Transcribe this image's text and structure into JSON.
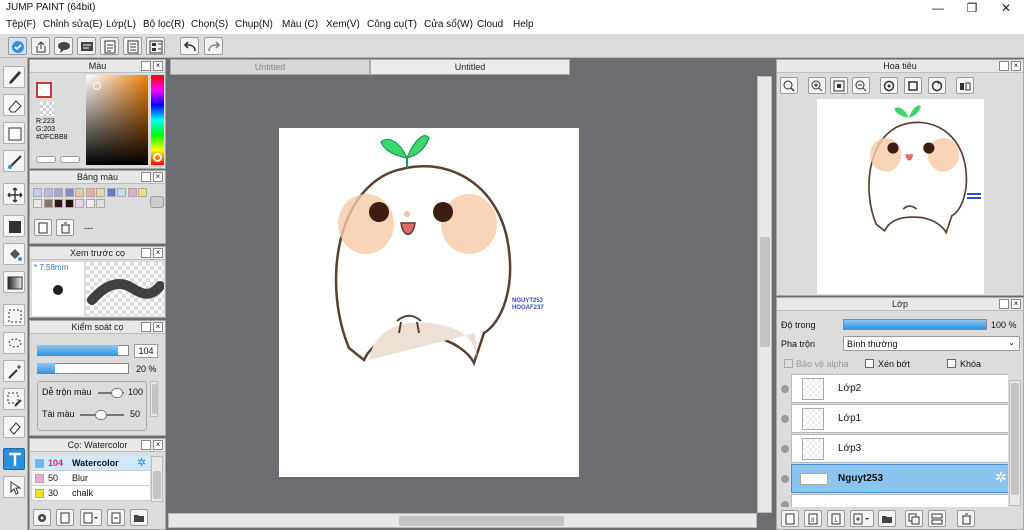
{
  "app": {
    "title": "JUMP PAINT (64bit)",
    "minimize": "—",
    "maximize": "❐",
    "close": "✕"
  },
  "menu": [
    "Tệp(F)",
    "Chỉnh sửa(E)",
    "Lớp(L)",
    "Bộ lọc(R)",
    "Chọn(S)",
    "Chụp(N)",
    "Màu (C)",
    "Xem(V)",
    "Công cụ(T)",
    "Cửa sổ(W)",
    "Cloud",
    "Help"
  ],
  "tabs": [
    "Untitled",
    "Untitled"
  ],
  "color_panel": {
    "title": "Màu",
    "r": "R:223",
    "g": "G:203",
    "b": "B:184",
    "hex": "#DFCBB8",
    "foreground": "#df6f6f"
  },
  "palette_panel": {
    "title": "Bảng màu",
    "dash": "---",
    "colors": [
      "#c8c8f0",
      "#b8b8e8",
      "#a8a8d8",
      "#8888c8",
      "#e8c8a8",
      "#f0a8a8",
      "#e8d8a8",
      "#6878d0",
      "#c8d8f0",
      "#e8a8c8",
      "#f0e070",
      "#e8e8e8",
      "#8a7060",
      "#301818",
      "#281010",
      "#f0d0e8",
      "#f0f0f0",
      "#e0e0e0"
    ]
  },
  "brush_preview": {
    "title": "Xem trước cọ",
    "size": "* 7.58mm"
  },
  "brush_control": {
    "title": "Kiểm soát cọ",
    "size_value": "104",
    "opacity_value": "20 %",
    "mix_label": "Dễ trộn màu",
    "mix_value": "100",
    "amount_label": "Tài màu",
    "amount_value": "50",
    "size_fill": 0.88,
    "opacity_fill": 0.2
  },
  "brush_list": {
    "title": "Cọ: Watercolor",
    "items": [
      {
        "size": "104",
        "name": "Watercolor",
        "color": "#6ab8f0"
      },
      {
        "size": "50",
        "name": "Blur",
        "color": "#f0a8d8"
      },
      {
        "size": "30",
        "name": "chalk",
        "color": "#f0e020"
      }
    ]
  },
  "navigator": {
    "title": "Hoa tiêu"
  },
  "layers": {
    "title": "Lớp",
    "opacity_label": "Độ trong",
    "opacity_value": "100 %",
    "blend_label": "Pha trộn",
    "blend_value": "Bình thường",
    "protect_alpha": "Bảo vệ alpha",
    "clip": "Xén bớt",
    "lock": "Khóa",
    "items": [
      "Lớp2",
      "Lớp1",
      "Lớp3",
      "Nguyt253"
    ]
  },
  "canvas": {
    "signature_line1": "NGUYT253",
    "signature_line2": "HOOAF237"
  }
}
